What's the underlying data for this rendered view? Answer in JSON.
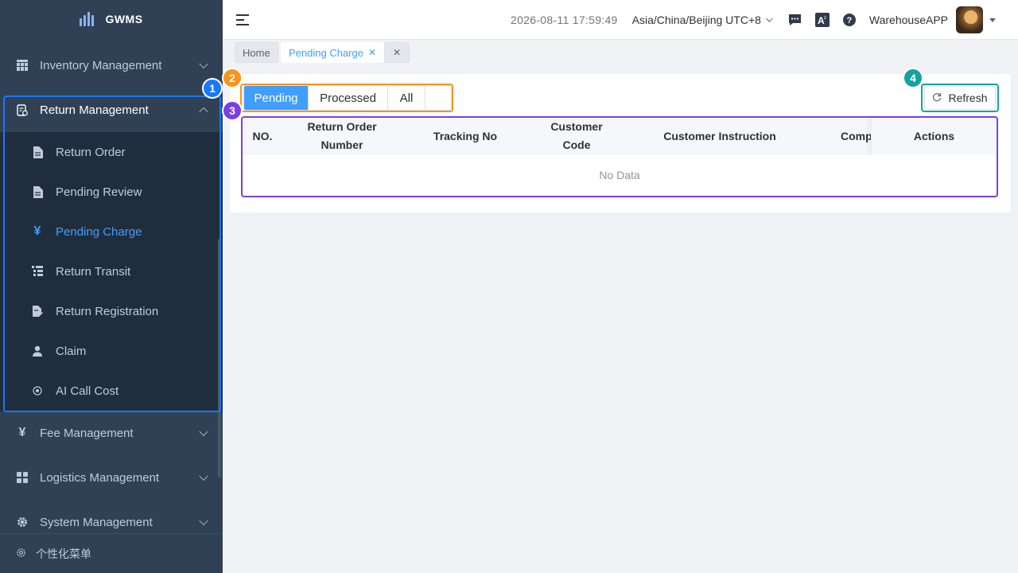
{
  "app": {
    "name": "GWMS"
  },
  "sidebar": {
    "inventory_label": "Inventory Management",
    "return_label": "Return Management",
    "sub_items": [
      "Return Order",
      "Pending Review",
      "Pending Charge",
      "Return Transit",
      "Return Registration",
      "Claim",
      "AI Call Cost"
    ],
    "active_sub": "Pending Charge",
    "fee_label": "Fee Management",
    "logistics_label": "Logistics Management",
    "system_label": "System Management",
    "personal_menu": "个性化菜单"
  },
  "header": {
    "datetime": "2026-08-11 17:59:49",
    "timezone": "Asia/China/Beijing UTC+8",
    "user": "WarehouseAPP"
  },
  "tags": {
    "home": "Home",
    "current": "Pending Charge"
  },
  "tabs": [
    "Pending",
    "Processed",
    "All"
  ],
  "active_tab": "Pending",
  "refresh_label": "Refresh",
  "table": {
    "columns": {
      "no": "NO.",
      "return_order_1": "Return Order",
      "return_order_2": "Number",
      "tracking": "Tracking No",
      "customer_1": "Customer",
      "customer_2": "Code",
      "instruction": "Customer Instruction",
      "comp": "Compl",
      "actions": "Actions"
    },
    "empty_text": "No Data"
  },
  "annotations": [
    "1",
    "2",
    "3",
    "4"
  ],
  "colors": {
    "sidebar_bg": "#304156",
    "submenu_bg": "#1f2d3d",
    "accent": "#409eff",
    "anno_blue": "#1677ff",
    "anno_orange": "#f7941d",
    "anno_purple": "#7b3fe4",
    "anno_teal": "#14a3a0"
  }
}
